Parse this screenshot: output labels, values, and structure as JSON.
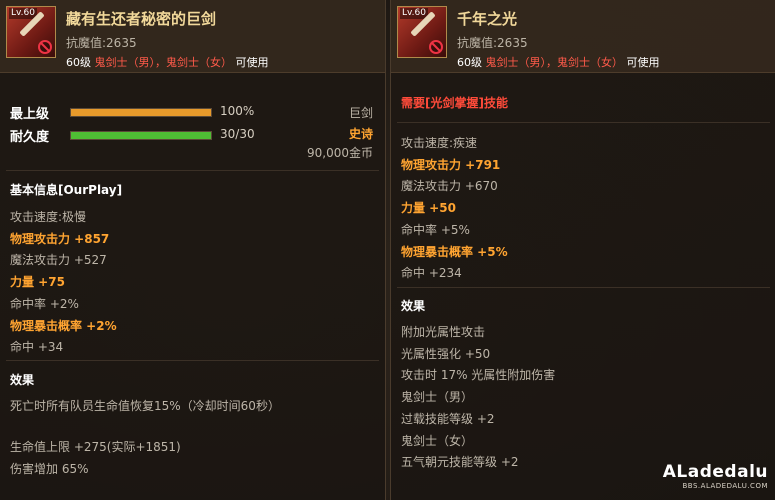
{
  "left": {
    "level_badge": "Lv.60",
    "title": "藏有生还者秘密的巨剑",
    "anti_magic": "抗魔值:2635",
    "req_prefix": "60级",
    "req_classes": "鬼剑士（男），鬼剑士（女）",
    "req_suffix": "可使用",
    "bars": [
      {
        "label": "最上级",
        "value_text": "100%",
        "fill_pct": 100,
        "color": "#e89a2b"
      },
      {
        "label": "耐久度",
        "value_text": "30/30",
        "fill_pct": 100,
        "color": "#4fbe34"
      }
    ],
    "type_label": "巨剑",
    "rarity_label": "史诗",
    "price": "90,000金币",
    "basic_info_title": "基本信息[OurPlay]",
    "stats": [
      {
        "text": "攻击速度:极慢",
        "highlight": false
      },
      {
        "text": "物理攻击力 +857",
        "highlight": true
      },
      {
        "text": "魔法攻击力 +527",
        "highlight": false
      },
      {
        "text": "力量 +75",
        "highlight": true
      },
      {
        "text": "命中率 +2%",
        "highlight": false
      },
      {
        "text": "物理暴击概率 +2%",
        "highlight": true
      },
      {
        "text": "命中 +34",
        "highlight": false
      }
    ],
    "effects_title": "效果",
    "effects": [
      "死亡时所有队员生命值恢复15%（冷却时间60秒）",
      "生命值上限 +275(实际+1851)",
      "伤害增加 65%"
    ]
  },
  "right": {
    "level_badge": "Lv.60",
    "title": "千年之光",
    "anti_magic": "抗魔值:2635",
    "req_prefix": "60级",
    "req_classes": "鬼剑士（男），鬼剑士（女）",
    "req_suffix": "可使用",
    "skill_req": "需要[光剑掌握]技能",
    "stats": [
      {
        "text": "攻击速度:疾速",
        "highlight": false
      },
      {
        "text": "物理攻击力 +791",
        "highlight": true
      },
      {
        "text": "魔法攻击力 +670",
        "highlight": false
      },
      {
        "text": "力量 +50",
        "highlight": true
      },
      {
        "text": "命中率 +5%",
        "highlight": false
      },
      {
        "text": "物理暴击概率 +5%",
        "highlight": true
      },
      {
        "text": "命中 +234",
        "highlight": false
      }
    ],
    "effects_title": "效果",
    "effects": [
      "附加光属性攻击",
      "光属性强化 +50",
      "攻击时 17% 光属性附加伤害",
      "鬼剑士（男）",
      "过载技能等级 +2",
      "鬼剑士（女）",
      "五气朝元技能等级 +2"
    ]
  },
  "watermark": {
    "brand": "ALadedalu",
    "url": "BBS.ALADEDALU.COM"
  },
  "colors": {
    "highlight": "#ffa431",
    "requirement_red": "#ff4b3a",
    "title_gold": "#f1d89a",
    "rarity": "#ffa431"
  }
}
